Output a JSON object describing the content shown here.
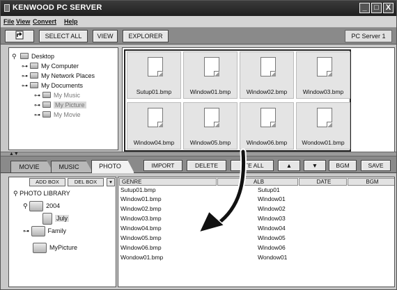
{
  "window": {
    "title": "KENWOOD PC SERVER",
    "controls": [
      "_",
      "□",
      "X"
    ]
  },
  "menu": [
    "File",
    "View",
    "Convert",
    "Help"
  ],
  "toolbar": {
    "select_all": "SELECT ALL",
    "view": "VIEW",
    "explorer": "EXPLORER",
    "server": "PC Server 1"
  },
  "tree": [
    {
      "label": "Desktop",
      "expanded": true
    },
    {
      "label": "My Computer"
    },
    {
      "label": "My Network Places"
    },
    {
      "label": "My Documents",
      "expanded": true
    },
    {
      "label": "My Music"
    },
    {
      "label": "My Picture",
      "selected": true
    },
    {
      "label": "My Movie"
    }
  ],
  "thumbnails": [
    "Sutup01.bmp",
    "Window01.bmp",
    "Window02.bmp",
    "Window03.bmp",
    "Window04.bmp",
    "Window05.bmp",
    "Window06.bmp",
    "Wondow01.bmp"
  ],
  "tabs": [
    "MOVIE",
    "MUSIC",
    "PHOTO"
  ],
  "actions": {
    "import": "IMPORT",
    "delete": "DELETE",
    "delete_all": "ETE ALL",
    "up": "▲",
    "down": "▼",
    "bgm": "BGM",
    "save": "SAVE"
  },
  "library": {
    "add_box": "ADD BOX",
    "del_box": "DEL BOX",
    "root": "PHOTO LIBRARY",
    "nodes": [
      "2004",
      "July",
      "Family",
      "MyPicture"
    ]
  },
  "list": {
    "columns": [
      "GENRE",
      "ALB",
      "DATE",
      "BGM"
    ],
    "rows": [
      [
        "Sutup01.bmp",
        "Sutup01"
      ],
      [
        "Window01.bmp",
        "Window01"
      ],
      [
        "Window02.bmp",
        "Window02"
      ],
      [
        "Window03.bmp",
        "Window03"
      ],
      [
        "Window04.bmp",
        "Window04"
      ],
      [
        "Window05.bmp",
        "Window05"
      ],
      [
        "Window06.bmp",
        "Window06"
      ],
      [
        "Wondow01.bmp",
        "Wondow01"
      ]
    ]
  }
}
